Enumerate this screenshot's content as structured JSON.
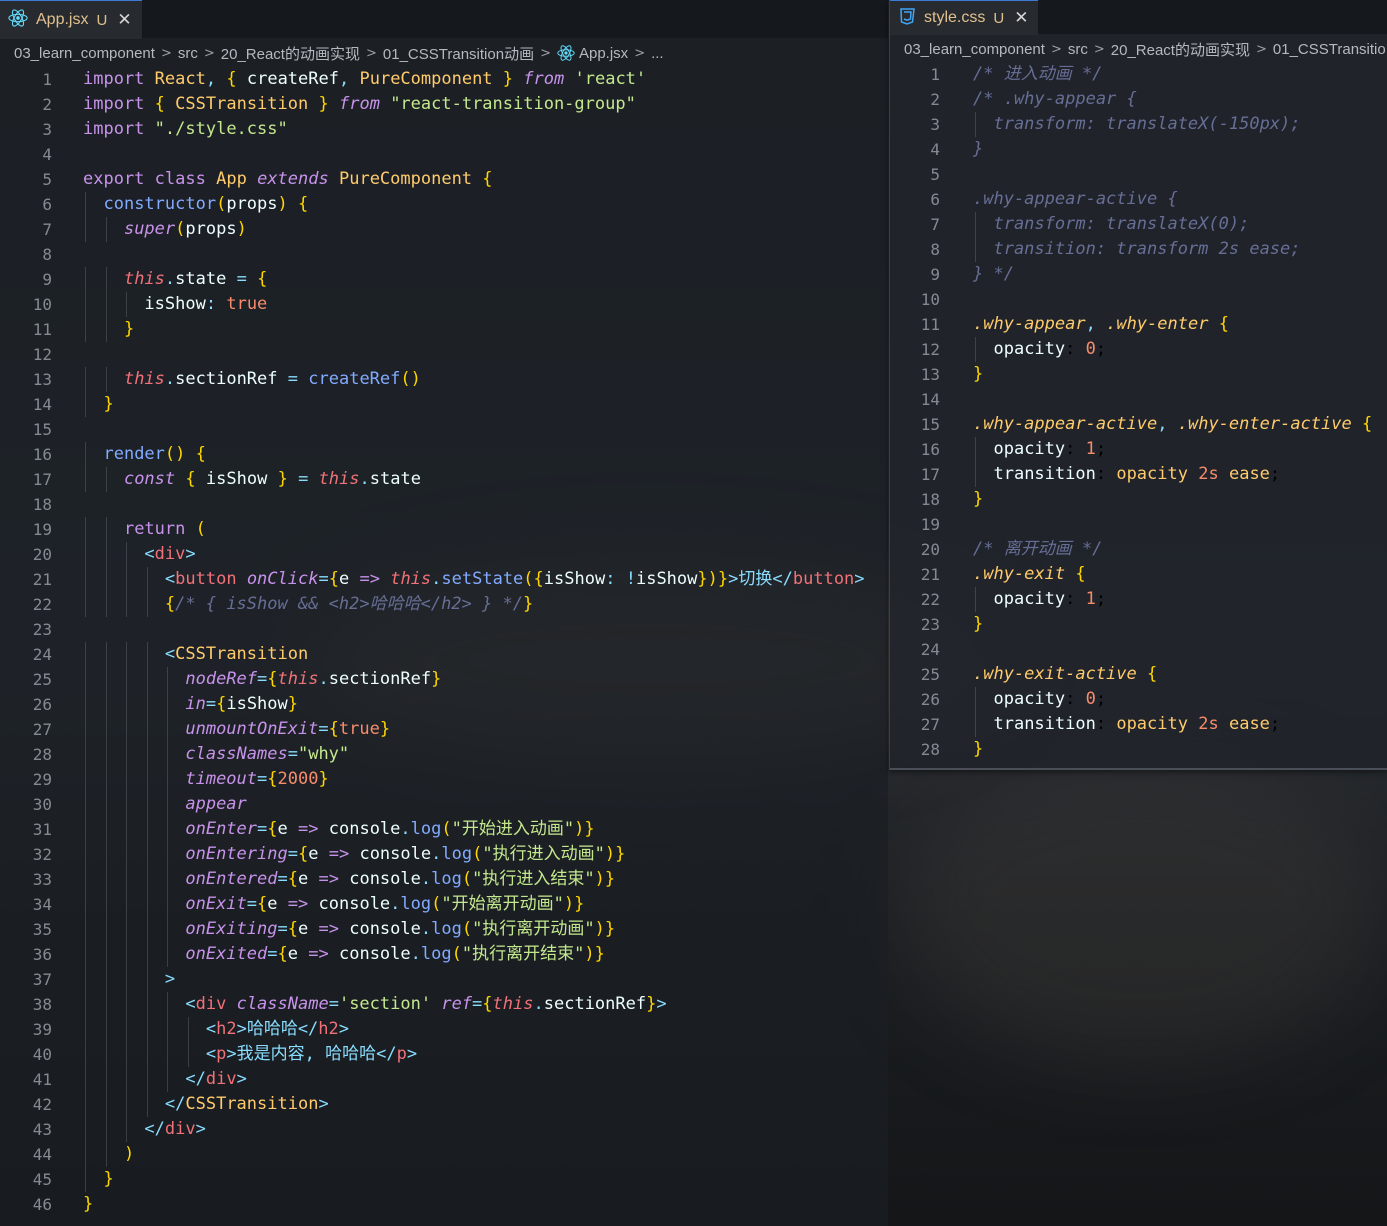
{
  "left_editor": {
    "tab": {
      "icon": "react-icon",
      "name": "App.jsx",
      "modified": "U"
    },
    "breadcrumb": [
      "03_learn_component",
      "src",
      "20_React的动画实现",
      "01_CSSTransition动画",
      "App.jsx",
      "..."
    ],
    "lines": [
      "import React, { createRef, PureComponent } from 'react'",
      "import { CSSTransition } from \"react-transition-group\"",
      "import \"./style.css\"",
      "",
      "export class App extends PureComponent {",
      "  constructor(props) {",
      "    super(props)",
      "",
      "    this.state = {",
      "      isShow: true",
      "    }",
      "",
      "    this.sectionRef = createRef()",
      "  }",
      "",
      "  render() {",
      "    const { isShow } = this.state",
      "",
      "    return (",
      "      <div>",
      "        <button onClick={e => this.setState({isShow: !isShow})}>切换</button>",
      "        {/* { isShow && <h2>哈哈哈</h2> } */}",
      "",
      "        <CSSTransition",
      "          nodeRef={this.sectionRef}",
      "          in={isShow}",
      "          unmountOnExit={true}",
      "          classNames=\"why\"",
      "          timeout={2000}",
      "          appear",
      "          onEnter={e => console.log(\"开始进入动画\")}",
      "          onEntering={e => console.log(\"执行进入动画\")}",
      "          onEntered={e => console.log(\"执行进入结束\")}",
      "          onExit={e => console.log(\"开始离开动画\")}",
      "          onExiting={e => console.log(\"执行离开动画\")}",
      "          onExited={e => console.log(\"执行离开结束\")}",
      "        >",
      "          <div className='section' ref={this.sectionRef}>",
      "            <h2>哈哈哈</h2>",
      "            <p>我是内容, 哈哈哈</p>",
      "          </div>",
      "        </CSSTransition>",
      "      </div>",
      "    )",
      "  }",
      "}"
    ]
  },
  "right_editor": {
    "tab": {
      "icon": "css3-icon",
      "name": "style.css",
      "modified": "U"
    },
    "breadcrumb": [
      "03_learn_component",
      "src",
      "20_React的动画实现",
      "01_CSSTransitio"
    ],
    "lines": [
      "/* 进入动画 */",
      "/* .why-appear {",
      "  transform: translateX(-150px);",
      "}",
      "",
      ".why-appear-active {",
      "  transform: translateX(0);",
      "  transition: transform 2s ease;",
      "} */",
      "",
      ".why-appear, .why-enter {",
      "  opacity: 0;",
      "}",
      "",
      ".why-appear-active, .why-enter-active {",
      "  opacity: 1;",
      "  transition: opacity 2s ease;",
      "}",
      "",
      "/* 离开动画 */",
      ".why-exit {",
      "  opacity: 1;",
      "}",
      "",
      ".why-exit-active {",
      "  opacity: 0;",
      "  transition: opacity 2s ease;",
      "}"
    ]
  },
  "colors": {
    "react_icon": "#61dafb",
    "css_icon": "#42a5f5",
    "tab_name": "#e2c08d",
    "modified": "#e2c08d",
    "keyword": "#c792ea",
    "string": "#c3e88d",
    "comment": "#676e95"
  }
}
